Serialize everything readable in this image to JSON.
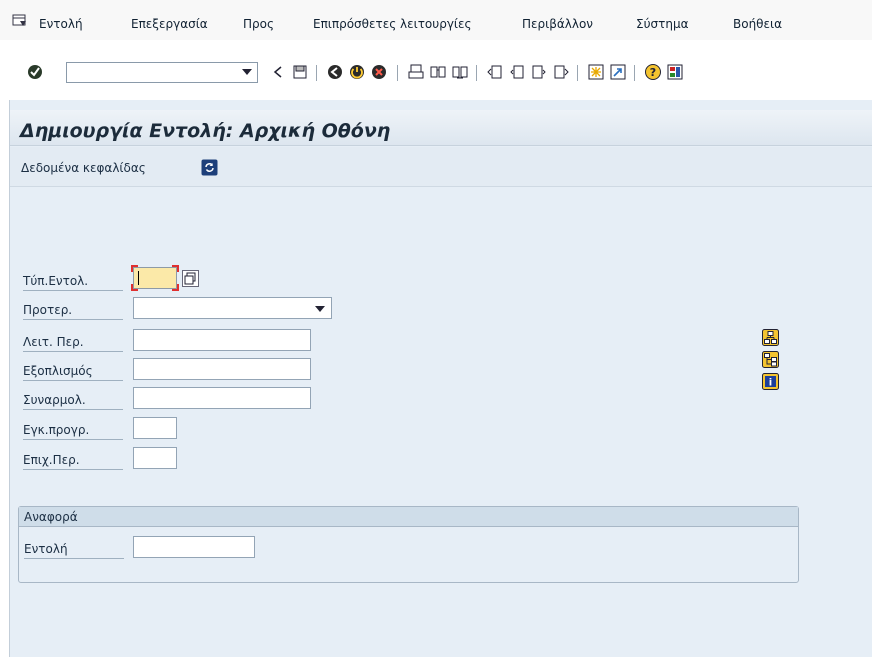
{
  "menu": {
    "items": [
      "Εντολή",
      "Επεξεργασία",
      "Προς",
      "Επιπρόσθετες λειτουργίες",
      "Περιβάλλον",
      "Σύστημα",
      "Βοήθεια"
    ]
  },
  "toolbar": {
    "command_value": "",
    "icons": [
      "enter-icon",
      "back-arrow-icon",
      "save-icon",
      "back-icon",
      "exit-icon",
      "cancel-icon",
      "print-icon",
      "find-icon",
      "find-next-icon",
      "first-page-icon",
      "previous-page-icon",
      "next-page-icon",
      "last-page-icon",
      "new-session-icon",
      "shortcut-icon",
      "help-icon",
      "customize-layout-icon"
    ]
  },
  "screen": {
    "title": "Δημιουργία Εντολή: Αρχική Οθόνη",
    "header_data_label": "Δεδομένα κεφαλίδας"
  },
  "form": {
    "fields": [
      {
        "label": "Τύπ.Εντολ.",
        "value": ""
      },
      {
        "label": "Προτερ.",
        "value": ""
      },
      {
        "label": "Λειτ. Περ.",
        "value": ""
      },
      {
        "label": "Εξοπλισμός",
        "value": ""
      },
      {
        "label": "Συναρμολ.",
        "value": ""
      },
      {
        "label": "Εγκ.προγρ.",
        "value": ""
      },
      {
        "label": "Επιχ.Περ.",
        "value": ""
      }
    ]
  },
  "reference": {
    "group_title": "Αναφορά",
    "order_label": "Εντολή",
    "order_value": ""
  },
  "colors": {
    "panel_bg": "#e6eef6",
    "accent_yellow": "#fbe9a8",
    "focus_red": "#e03030"
  }
}
